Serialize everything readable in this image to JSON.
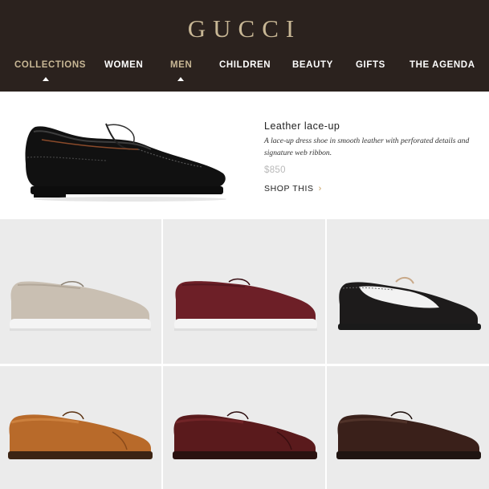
{
  "brand": {
    "logo_text": "GUCCI"
  },
  "nav": {
    "items": [
      {
        "label": "COLLECTIONS",
        "active": true
      },
      {
        "label": "WOMEN",
        "active": false
      },
      {
        "label": "MEN",
        "active": true
      },
      {
        "label": "CHILDREN",
        "active": false
      },
      {
        "label": "BEAUTY",
        "active": false
      },
      {
        "label": "GIFTS",
        "active": false
      },
      {
        "label": "THE AGENDA",
        "active": false
      }
    ]
  },
  "featured": {
    "title": "Leather lace-up",
    "description": "A lace-up dress shoe in smooth leather with perforated details and signature web ribbon.",
    "price": "$850",
    "cta_label": "SHOP THIS",
    "cta_icon": "chevron-right-icon"
  },
  "products": [
    {
      "name": "beige suede lace-up",
      "upper_color": "#c9bfb2",
      "sole_color": "#f4f4f4"
    },
    {
      "name": "burgundy suede lace-up",
      "upper_color": "#6d1f27",
      "sole_color": "#f4f4f4"
    },
    {
      "name": "black and white brogue",
      "upper_color": "#1d1b1b",
      "accent_color": "#f2f2f2",
      "sole_color": "#1a1a1a"
    },
    {
      "name": "cognac cap-toe oxford",
      "upper_color": "#b86a2a",
      "sole_color": "#3c2414"
    },
    {
      "name": "burgundy cap-toe oxford",
      "upper_color": "#5a1a1c",
      "sole_color": "#2a1210"
    },
    {
      "name": "dark brown plain-toe oxford",
      "upper_color": "#3a201a",
      "sole_color": "#1f1411"
    }
  ],
  "colors": {
    "header_bg": "#2b221e",
    "gold": "#c8b795",
    "tile_bg": "#ebebeb"
  }
}
